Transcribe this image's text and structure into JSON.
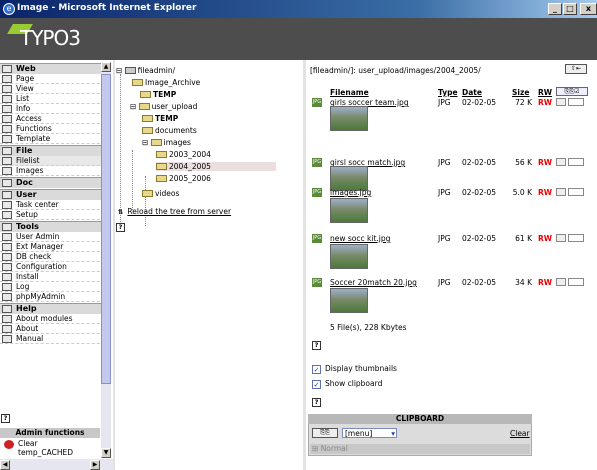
{
  "window": {
    "title": "Image - Microsoft Internet Explorer",
    "min": "_",
    "max": "□",
    "close": "x"
  },
  "logo": "TYPO3",
  "menu": [
    {
      "category": "Web",
      "items": [
        "Page",
        "View",
        "List",
        "Info",
        "Access",
        "Functions",
        "Template"
      ]
    },
    {
      "category": "File",
      "items": [
        "Filelist",
        "Images"
      ]
    },
    {
      "category": "Doc",
      "items": []
    },
    {
      "category": "User",
      "items": [
        "Task center",
        "Setup"
      ]
    },
    {
      "category": "Tools",
      "items": [
        "User Admin",
        "Ext Manager",
        "DB check",
        "Configuration",
        "Install",
        "Log",
        "phpMyAdmin"
      ]
    },
    {
      "category": "Help",
      "items": [
        "About modules",
        "About",
        "Manual"
      ]
    }
  ],
  "admin": {
    "heading": "Admin functions",
    "clear_label": "Clear",
    "clear_sub": "temp_CACHED"
  },
  "tree": {
    "root": "fileadmin/",
    "nodes": [
      "Image_Archive",
      "TEMP",
      "user_upload",
      "TEMP",
      "documents",
      "images",
      "2003_2004",
      "2004_2005",
      "2005_2006",
      "videos"
    ],
    "reload": "Reload the tree from server"
  },
  "content": {
    "path": "[fileadmin/]: user_upload/images/2004_2005/",
    "headers": {
      "filename": "Filename",
      "type": "Type",
      "date": "Date",
      "size": "Size",
      "rw": "RW"
    },
    "files": [
      {
        "name": "girls soccer team.jpg",
        "type": "JPG",
        "date": "02-02-05",
        "size": "72 K",
        "rw": "RW"
      },
      {
        "name": "girsl socc match.jpg",
        "type": "JPG",
        "date": "02-02-05",
        "size": "56 K",
        "rw": "RW"
      },
      {
        "name": "images.jpg",
        "type": "JPG",
        "date": "02-02-05",
        "size": "5.0 K",
        "rw": "RW"
      },
      {
        "name": "new socc kit.jpg",
        "type": "JPG",
        "date": "02-02-05",
        "size": "61 K",
        "rw": "RW"
      },
      {
        "name": "Soccer  20match 20.jpg",
        "type": "JPG",
        "date": "02-02-05",
        "size": "34 K",
        "rw": "RW"
      }
    ],
    "summary": "5 File(s), 228 Kbytes",
    "display_thumbnails": "Display thumbnails",
    "show_clipboard": "Show clipboard"
  },
  "clipboard": {
    "title": "CLIPBOARD",
    "menu": "[menu]",
    "clear": "Clear",
    "normal": "Normal"
  }
}
